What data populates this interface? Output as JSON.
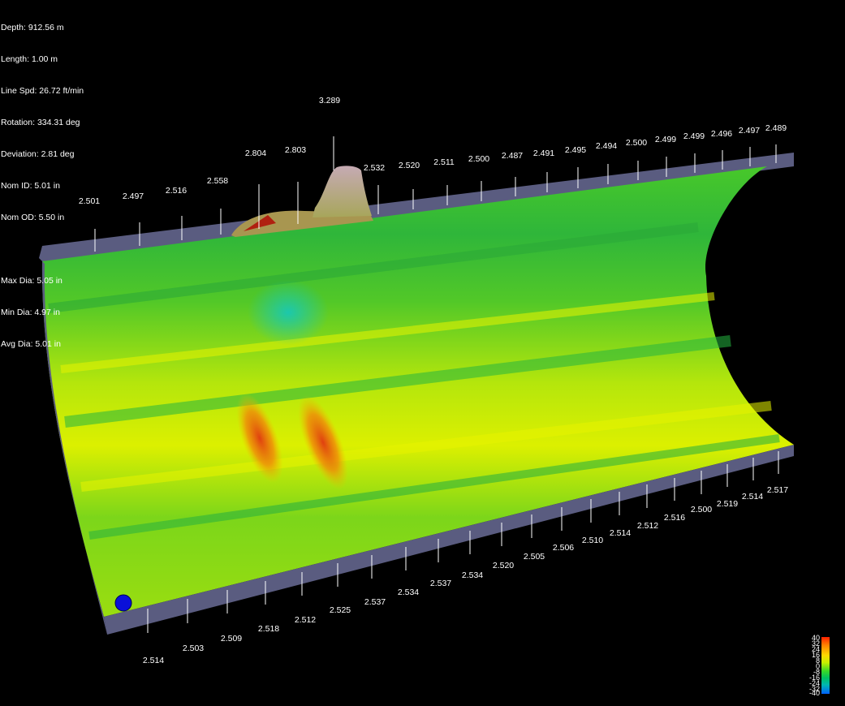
{
  "info": {
    "depth": "Depth: 912.56 m",
    "length": "Length: 1.00 m",
    "line_speed": "Line Spd: 26.72 ft/min",
    "rotation": "Rotation: 334.31 deg",
    "deviation": "Deviation: 2.81 deg",
    "nom_id": "Nom ID: 5.01 in",
    "nom_od": "Nom OD: 5.50 in",
    "max_dia": "Max Dia: 5.05 in",
    "min_dia": "Min Dia: 4.97 in",
    "avg_dia": "Avg Dia: 5.01 in"
  },
  "top_labels": [
    "2.501",
    "2.497",
    "2.516",
    "2.558",
    "2.804",
    "2.803",
    "3.289",
    "2.532",
    "2.520",
    "2.511",
    "2.500",
    "2.487",
    "2.491",
    "2.495",
    "2.494",
    "2.500",
    "2.499",
    "2.499",
    "2.496",
    "2.497",
    "2.489"
  ],
  "bottom_labels": [
    "2.514",
    "2.503",
    "2.509",
    "2.518",
    "2.512",
    "2.525",
    "2.537",
    "2.534",
    "2.537",
    "2.534",
    "2.520",
    "2.505",
    "2.506",
    "2.510",
    "2.514",
    "2.512",
    "2.516",
    "2.500",
    "2.519",
    "2.514",
    "2.517"
  ],
  "legend": {
    "ticks": [
      "40",
      "32",
      "24",
      "16",
      "8",
      "0",
      "-8",
      "-16",
      "-24",
      "-32",
      "-40"
    ]
  },
  "colors": {
    "rim": "#5a5c80",
    "surface_green": "#3cc028",
    "surface_yellow": "#d8f000",
    "hotspot": "#e05010",
    "marker": "#0a10d8"
  }
}
